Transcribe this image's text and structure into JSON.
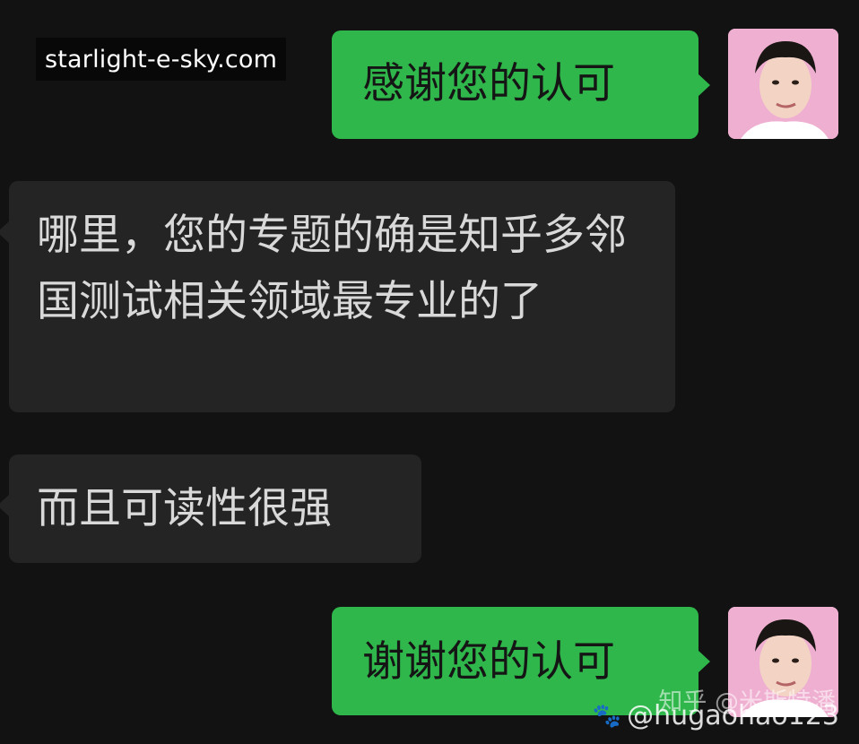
{
  "watermark_top": "starlight-e-sky.com",
  "messages": [
    {
      "id": "msg1",
      "direction": "outgoing",
      "text": "感谢您的认可"
    },
    {
      "id": "msg2",
      "direction": "incoming",
      "text": "哪里，您的专题的确是知乎多邻国测试相关领域最专业的了"
    },
    {
      "id": "msg3",
      "direction": "incoming",
      "text": "而且可读性很强"
    },
    {
      "id": "msg4",
      "direction": "outgoing",
      "text": "谢谢您的认可"
    }
  ],
  "watermark_bottom": {
    "zhihu": "知乎 @米斯特潘",
    "handle": "@hugaohao123",
    "paw_icon": "paw-icon"
  },
  "colors": {
    "background": "#121212",
    "outgoing_bubble": "#2fb74b",
    "incoming_bubble": "#242424",
    "incoming_text": "#d9d9d9"
  }
}
